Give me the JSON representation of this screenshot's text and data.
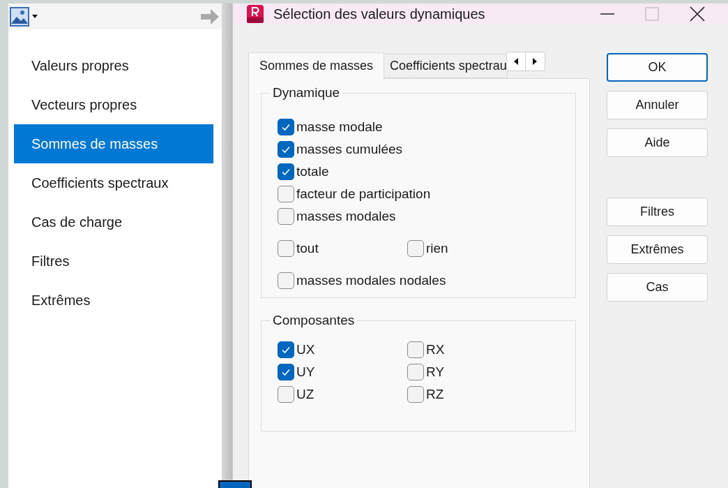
{
  "sidebar": {
    "items": [
      {
        "label": "Valeurs propres",
        "selected": false
      },
      {
        "label": "Vecteurs propres",
        "selected": false
      },
      {
        "label": "Sommes de masses",
        "selected": true
      },
      {
        "label": "Coefficients spectraux",
        "selected": false
      },
      {
        "label": "Cas de charge",
        "selected": false
      },
      {
        "label": "Filtres",
        "selected": false
      },
      {
        "label": "Extrêmes",
        "selected": false
      }
    ]
  },
  "dialog": {
    "title": "Sélection des valeurs dynamiques",
    "tabs": [
      {
        "label": "Sommes de masses",
        "selected": true
      },
      {
        "label": "Coefficients spectrau",
        "selected": false
      }
    ],
    "groups": [
      {
        "title": "Dynamique",
        "sections": [
          [
            [
              {
                "label": "masse modale",
                "checked": true
              }
            ],
            [
              {
                "label": "masses cumulées",
                "checked": true
              }
            ],
            [
              {
                "label": "totale",
                "checked": true
              }
            ],
            [
              {
                "label": "facteur de participation",
                "checked": false
              }
            ],
            [
              {
                "label": "masses modales",
                "checked": false
              }
            ]
          ],
          [
            [
              {
                "label": "tout",
                "checked": false
              },
              {
                "label": "rien",
                "checked": false
              }
            ]
          ],
          [
            [
              {
                "label": "masses modales nodales",
                "checked": false
              }
            ]
          ]
        ]
      },
      {
        "title": "Composantes",
        "sections": [
          [
            [
              {
                "label": "UX",
                "checked": true
              },
              {
                "label": "RX",
                "checked": false
              }
            ],
            [
              {
                "label": "UY",
                "checked": true
              },
              {
                "label": "RY",
                "checked": false
              }
            ],
            [
              {
                "label": "UZ",
                "checked": false
              },
              {
                "label": "RZ",
                "checked": false
              }
            ]
          ]
        ]
      }
    ],
    "buttons": [
      [
        {
          "label": "OK",
          "default": true
        },
        {
          "label": "Annuler",
          "default": false
        },
        {
          "label": "Aide",
          "default": false
        }
      ],
      [
        {
          "label": "Filtres",
          "default": false
        },
        {
          "label": "Extrêmes",
          "default": false
        },
        {
          "label": "Cas",
          "default": false
        }
      ]
    ]
  }
}
